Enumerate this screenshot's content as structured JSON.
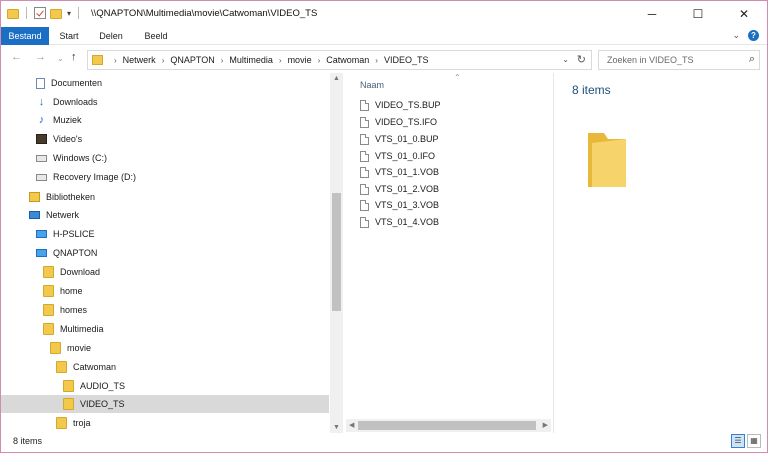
{
  "window": {
    "title": "\\\\QNAPTON\\Multimedia\\movie\\Catwoman\\VIDEO_TS",
    "controls": {
      "minimize": "─",
      "maximize": "☐",
      "close": "✕"
    }
  },
  "ribbon": {
    "tabs": [
      "Bestand",
      "Start",
      "Delen",
      "Beeld"
    ]
  },
  "address": {
    "crumbs": [
      "Netwerk",
      "QNAPTON",
      "Multimedia",
      "movie",
      "Catwoman",
      "VIDEO_TS"
    ],
    "search_placeholder": "Zoeken in VIDEO_TS"
  },
  "nav": {
    "items": [
      {
        "label": "Documenten",
        "icon": "documents-icon"
      },
      {
        "label": "Downloads",
        "icon": "downloads-icon"
      },
      {
        "label": "Muziek",
        "icon": "music-icon"
      },
      {
        "label": "Video's",
        "icon": "videos-icon"
      },
      {
        "label": "Windows (C:)",
        "icon": "drive-icon"
      },
      {
        "label": "Recovery Image (D:)",
        "icon": "drive-icon"
      },
      {
        "label": "Bibliotheken",
        "icon": "libraries-icon"
      },
      {
        "label": "Netwerk",
        "icon": "network-icon"
      },
      {
        "label": "H-PSLICE",
        "icon": "computer-icon"
      },
      {
        "label": "QNAPTON",
        "icon": "computer-icon"
      },
      {
        "label": "Download",
        "icon": "folder-icon"
      },
      {
        "label": "home",
        "icon": "folder-icon"
      },
      {
        "label": "homes",
        "icon": "folder-icon"
      },
      {
        "label": "Multimedia",
        "icon": "folder-icon"
      },
      {
        "label": "movie",
        "icon": "folder-icon"
      },
      {
        "label": "Catwoman",
        "icon": "folder-icon"
      },
      {
        "label": "AUDIO_TS",
        "icon": "folder-icon"
      },
      {
        "label": "VIDEO_TS",
        "icon": "folder-icon",
        "selected": true
      },
      {
        "label": "troja",
        "icon": "folder-icon"
      }
    ]
  },
  "filelist": {
    "column_header": "Naam",
    "files": [
      "VIDEO_TS.BUP",
      "VIDEO_TS.IFO",
      "VTS_01_0.BUP",
      "VTS_01_0.IFO",
      "VTS_01_1.VOB",
      "VTS_01_2.VOB",
      "VTS_01_3.VOB",
      "VTS_01_4.VOB"
    ]
  },
  "details": {
    "count": "8 items"
  },
  "status": {
    "text": "8 items"
  },
  "colors": {
    "accent": "#1a6fc5",
    "folder": "#f2c94c",
    "selection": "#d9d9d9"
  }
}
